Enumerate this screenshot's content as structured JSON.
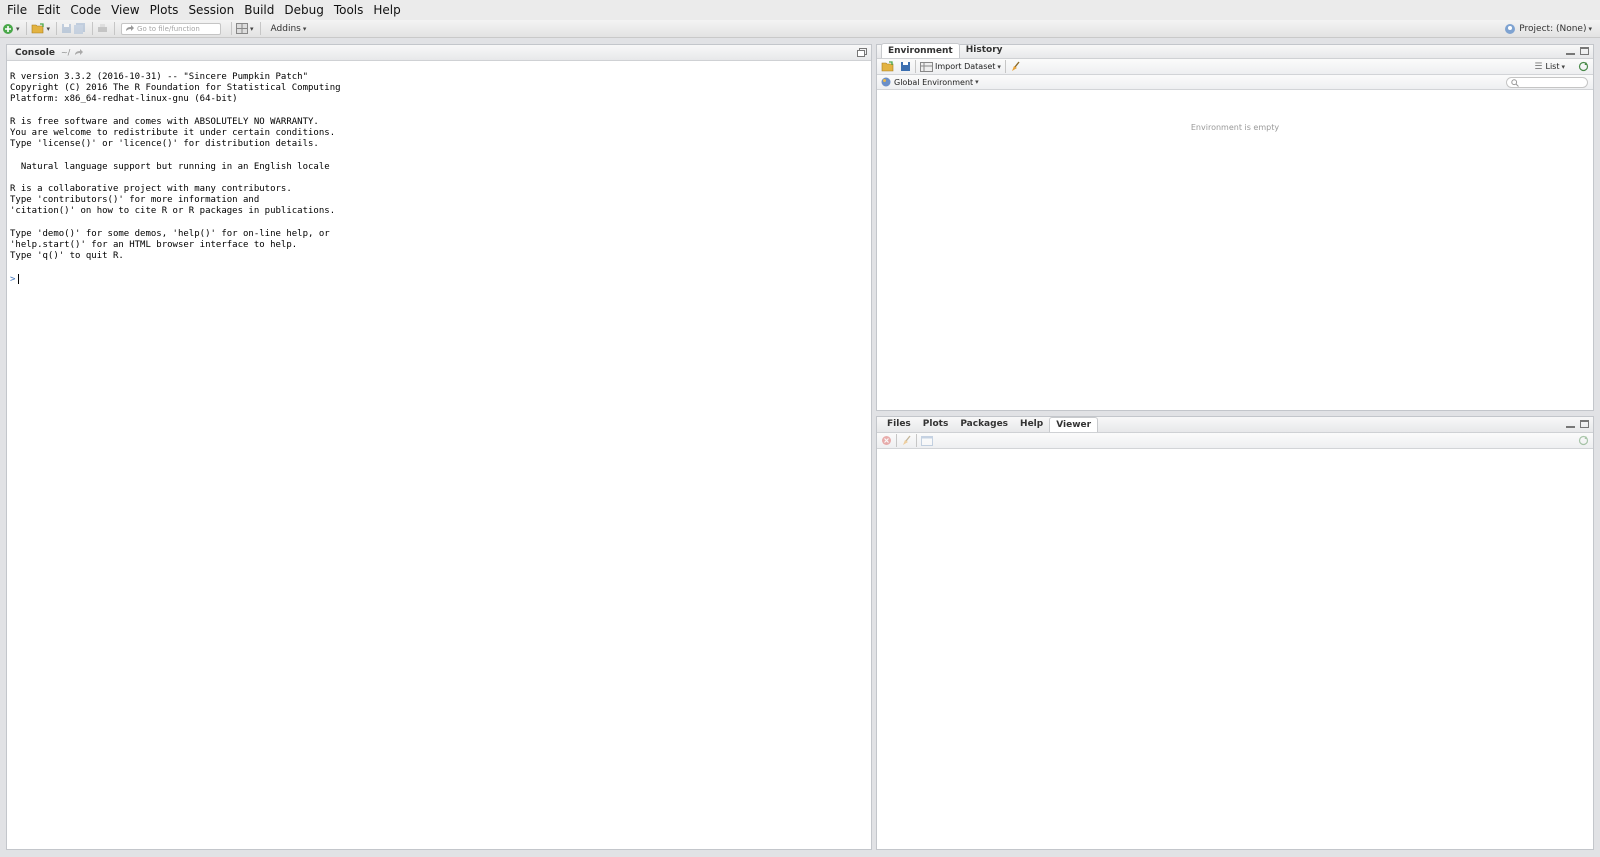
{
  "menubar": {
    "items": [
      {
        "label": "File"
      },
      {
        "label": "Edit"
      },
      {
        "label": "Code"
      },
      {
        "label": "View"
      },
      {
        "label": "Plots"
      },
      {
        "label": "Session"
      },
      {
        "label": "Build"
      },
      {
        "label": "Debug"
      },
      {
        "label": "Tools"
      },
      {
        "label": "Help"
      }
    ]
  },
  "toolbar": {
    "goto_placeholder": "Go to file/function",
    "addins_label": "Addins",
    "project_label": "Project: (None)"
  },
  "console": {
    "tab_label": "Console",
    "path": "~/",
    "lines": [
      "R version 3.3.2 (2016-10-31) -- \"Sincere Pumpkin Patch\"",
      "Copyright (C) 2016 The R Foundation for Statistical Computing",
      "Platform: x86_64-redhat-linux-gnu (64-bit)",
      "",
      "R is free software and comes with ABSOLUTELY NO WARRANTY.",
      "You are welcome to redistribute it under certain conditions.",
      "Type 'license()' or 'licence()' for distribution details.",
      "",
      "  Natural language support but running in an English locale",
      "",
      "R is a collaborative project with many contributors.",
      "Type 'contributors()' for more information and",
      "'citation()' on how to cite R or R packages in publications.",
      "",
      "Type 'demo()' for some demos, 'help()' for on-line help, or",
      "'help.start()' for an HTML browser interface to help.",
      "Type 'q()' to quit R."
    ],
    "prompt": ">"
  },
  "env_pane": {
    "tabs": [
      {
        "label": "Environment"
      },
      {
        "label": "History"
      }
    ],
    "import_label": "Import Dataset",
    "list_label": "List",
    "scope_label": "Global Environment",
    "empty_message": "Environment is empty"
  },
  "files_pane": {
    "tabs": [
      {
        "label": "Files"
      },
      {
        "label": "Plots"
      },
      {
        "label": "Packages"
      },
      {
        "label": "Help"
      },
      {
        "label": "Viewer"
      }
    ]
  },
  "colors": {
    "accent": "#3a6fb7",
    "background": "#e1e2e5"
  }
}
